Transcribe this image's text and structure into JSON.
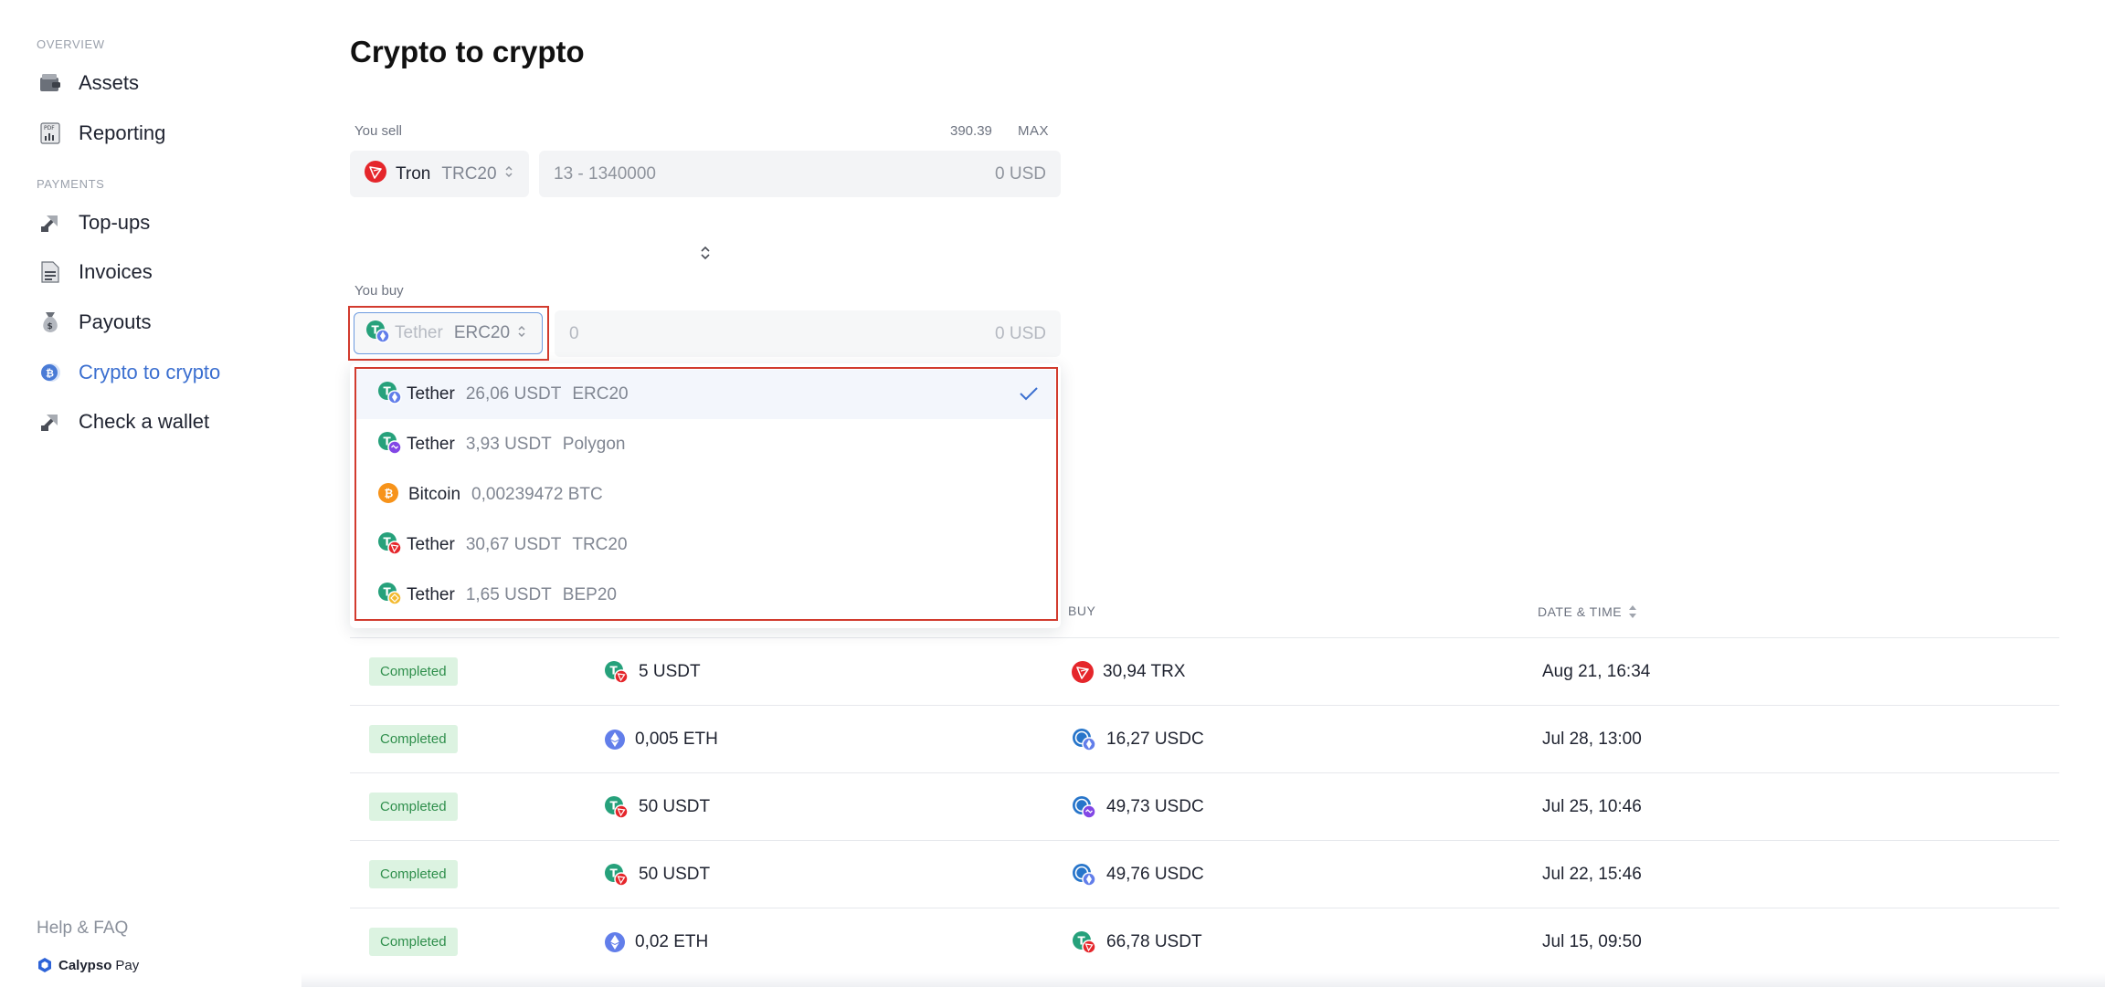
{
  "sidebar": {
    "section_overview": "OVERVIEW",
    "section_payments": "PAYMENTS",
    "items": [
      {
        "label": "Assets",
        "icon": "wallet-icon"
      },
      {
        "label": "Reporting",
        "icon": "pdf-report-icon"
      },
      {
        "label": "Top-ups",
        "icon": "arrow-in-icon"
      },
      {
        "label": "Invoices",
        "icon": "document-icon"
      },
      {
        "label": "Payouts",
        "icon": "money-bag-icon"
      },
      {
        "label": "Crypto to crypto",
        "icon": "bitcoin-exchange-icon",
        "active": true
      },
      {
        "label": "Check a wallet",
        "icon": "arrow-check-icon"
      }
    ],
    "help": "Help & FAQ",
    "brand": "Calypso",
    "brand_suffix": "Pay"
  },
  "page": {
    "title": "Crypto to crypto"
  },
  "sell": {
    "label": "You sell",
    "balance": "390.39",
    "max": "MAX",
    "coin": "Tron",
    "network": "TRC20",
    "amount_placeholder": "13 - 1340000",
    "usd": "0 USD"
  },
  "buy": {
    "label": "You buy",
    "coin": "Tether",
    "network": "ERC20",
    "amount_placeholder": "0",
    "usd": "0 USD"
  },
  "dropdown": [
    {
      "name": "Tether",
      "amount": "26,06 USDT",
      "network": "ERC20",
      "selected": true
    },
    {
      "name": "Tether",
      "amount": "3,93 USDT",
      "network": "Polygon"
    },
    {
      "name": "Bitcoin",
      "amount": "0,00239472 BTC",
      "network": ""
    },
    {
      "name": "Tether",
      "amount": "30,67 USDT",
      "network": "TRC20"
    },
    {
      "name": "Tether",
      "amount": "1,65 USDT",
      "network": "BEP20"
    }
  ],
  "table": {
    "headers": {
      "buy": "BUY",
      "date": "DATE & TIME"
    },
    "rows": [
      {
        "status": "Completed",
        "sell": "5 USDT",
        "buy": "30,94 TRX",
        "date": "Aug 21, 16:34"
      },
      {
        "status": "Completed",
        "sell": "0,005 ETH",
        "buy": "16,27 USDC",
        "date": "Jul 28, 13:00"
      },
      {
        "status": "Completed",
        "sell": "50 USDT",
        "buy": "49,73 USDC",
        "date": "Jul 25, 10:46"
      },
      {
        "status": "Completed",
        "sell": "50 USDT",
        "buy": "49,76 USDC",
        "date": "Jul 22, 15:46"
      },
      {
        "status": "Completed",
        "sell": "0,02 ETH",
        "buy": "66,78 USDT",
        "date": "Jul 15, 09:50"
      }
    ]
  },
  "colors": {
    "accent": "#3b6fd0",
    "highlight": "#d23b2e",
    "tether": "#26a17b",
    "tron": "#e5262b",
    "bitcoin": "#f7931a",
    "ethereum": "#627eea",
    "usdc": "#2775ca",
    "polygon": "#8247e5",
    "bnb": "#f3ba2f",
    "completed_bg": "#dcf3e1"
  }
}
